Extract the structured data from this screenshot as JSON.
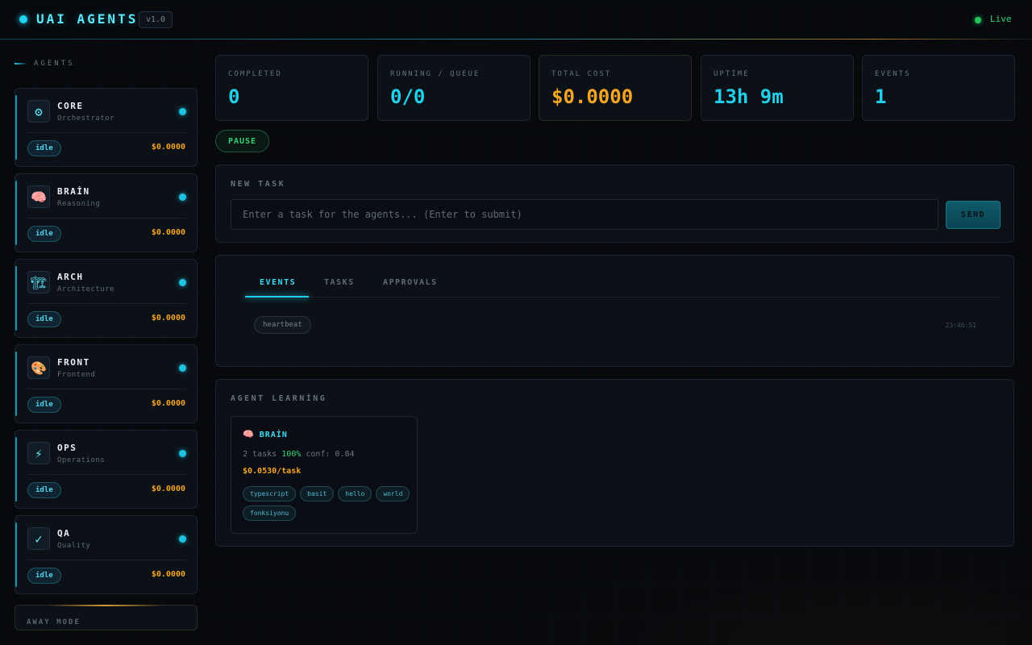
{
  "header": {
    "title": "UAI AGENTS",
    "version": "v1.0",
    "status": "Live"
  },
  "sidebar": {
    "heading": "AGENTS",
    "agents": [
      {
        "name": "CORE",
        "role": "Orchestrator",
        "icon": "⚙",
        "icon_name": "gear-icon",
        "state": "idle",
        "cost": "$0.0000"
      },
      {
        "name": "BRAİN",
        "role": "Reasoning",
        "icon": "🧠",
        "icon_name": "brain-icon",
        "state": "idle",
        "cost": "$0.0000"
      },
      {
        "name": "ARCH",
        "role": "Architecture",
        "icon": "🏗",
        "icon_name": "crane-icon",
        "state": "idle",
        "cost": "$0.0000"
      },
      {
        "name": "FRONT",
        "role": "Frontend",
        "icon": "🎨",
        "icon_name": "palette-icon",
        "state": "idle",
        "cost": "$0.0000"
      },
      {
        "name": "OPS",
        "role": "Operations",
        "icon": "⚡",
        "icon_name": "lightning-icon",
        "state": "idle",
        "cost": "$0.0000"
      },
      {
        "name": "QA",
        "role": "Quality",
        "icon": "✓",
        "icon_name": "check-icon",
        "state": "idle",
        "cost": "$0.0000"
      }
    ],
    "away_mode": "AWAY MODE"
  },
  "stats": [
    {
      "label": "COMPLETED",
      "value": "0"
    },
    {
      "label": "RUNNING / QUEUE",
      "value": "0/0"
    },
    {
      "label": "TOTAL COST",
      "value": "$0.0000"
    },
    {
      "label": "UPTİME",
      "value": "13h 9m"
    },
    {
      "label": "EVENTS",
      "value": "1"
    }
  ],
  "controls": {
    "pause_label": "PAUSE"
  },
  "new_task": {
    "title": "NEW TASK",
    "placeholder": "Enter a task for the agents... (Enter to submit)",
    "value": "",
    "send_label": "SEND"
  },
  "tabs": [
    {
      "label": "EVENTS",
      "active": true
    },
    {
      "label": "TASKS",
      "active": false
    },
    {
      "label": "APPROVALS",
      "active": false
    }
  ],
  "events": [
    {
      "type": "heartbeat",
      "time": "23:46:51"
    }
  ],
  "learning": {
    "title": "AGENT LEARNİNG",
    "cards": [
      {
        "agent": "BRAİN",
        "icon": "🧠",
        "tasks": "2 tasks",
        "success": "100%",
        "confidence": "conf: 0.84",
        "cost": "$0.0530/task",
        "tags": [
          "typescript",
          "basit",
          "hello",
          "world",
          "fonksiyonu"
        ]
      }
    ]
  },
  "colors": {
    "accent": "#22cfe8",
    "cost": "#f5a524",
    "live": "#22c55e",
    "background": "#07090d"
  }
}
